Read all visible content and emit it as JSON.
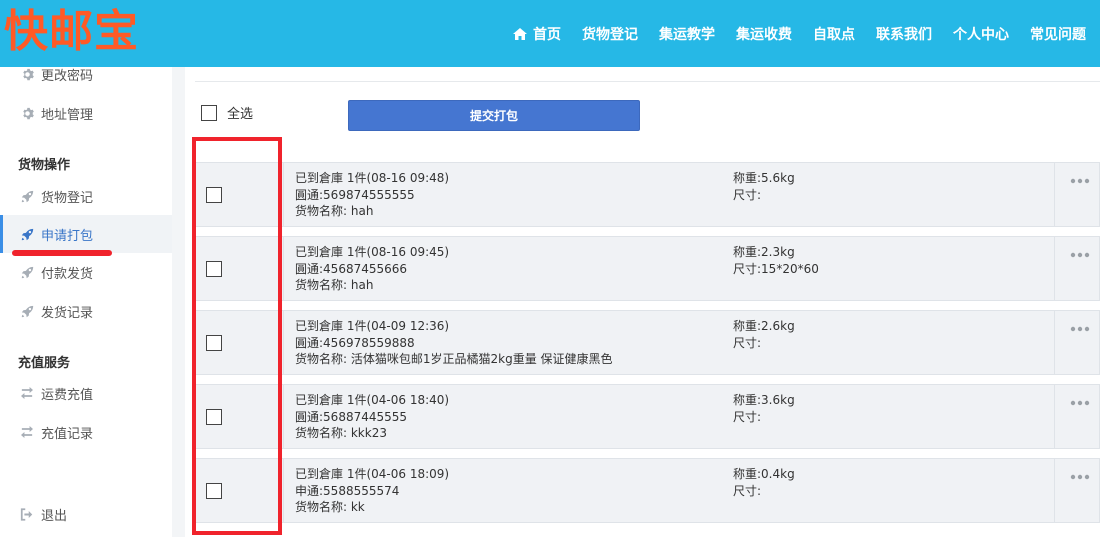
{
  "header": {
    "logo": "快邮宝",
    "nav": [
      "首页",
      "货物登记",
      "集运教学",
      "集运收费",
      "自取点",
      "联系我们",
      "个人中心",
      "常见问题"
    ]
  },
  "sidebar": {
    "account_items": [
      {
        "label": "更改密码",
        "icon": "gear-icon"
      },
      {
        "label": "地址管理",
        "icon": "gear-icon"
      }
    ],
    "cargo_heading": "货物操作",
    "cargo_items": [
      {
        "label": "货物登记",
        "icon": "rocket-icon"
      },
      {
        "label": "申请打包",
        "icon": "rocket-icon",
        "active": true
      },
      {
        "label": "付款发货",
        "icon": "rocket-icon"
      },
      {
        "label": "发货记录",
        "icon": "rocket-icon"
      }
    ],
    "recharge_heading": "充值服务",
    "recharge_items": [
      {
        "label": "运费充值",
        "icon": "swap-icon"
      },
      {
        "label": "充值记录",
        "icon": "swap-icon"
      }
    ],
    "logout": {
      "label": "退出",
      "icon": "logout-icon"
    }
  },
  "content": {
    "select_all_label": "全选",
    "submit_label": "提交打包",
    "packages": [
      {
        "status": "已到倉庫 1件(08-16 09:48)",
        "tracking": "圓通:569874555555",
        "name": "货物名称: hah",
        "weight": "称重:5.6kg",
        "size": "尺寸:"
      },
      {
        "status": "已到倉庫 1件(08-16 09:45)",
        "tracking": "圓通:45687455666",
        "name": "货物名称: hah",
        "weight": "称重:2.3kg",
        "size": "尺寸:15*20*60"
      },
      {
        "status": "已到倉庫 1件(04-09 12:36)",
        "tracking": "圓通:456978559888",
        "name": "货物名称: 活体猫咪包邮1岁正品橘猫2kg重量 保证健康黑色",
        "weight": "称重:2.6kg",
        "size": "尺寸:"
      },
      {
        "status": "已到倉庫 1件(04-06 18:40)",
        "tracking": "圓通:56887445555",
        "name": "货物名称: kkk23",
        "weight": "称重:3.6kg",
        "size": "尺寸:"
      },
      {
        "status": "已到倉庫 1件(04-06 18:09)",
        "tracking": "申通:5588555574",
        "name": "货物名称: kk",
        "weight": "称重:0.4kg",
        "size": "尺寸:"
      }
    ]
  },
  "colors": {
    "header_bg": "#26b8e6",
    "logo": "#ff5a26",
    "button_bg": "#4576d1",
    "annotation": "#f0232c"
  }
}
